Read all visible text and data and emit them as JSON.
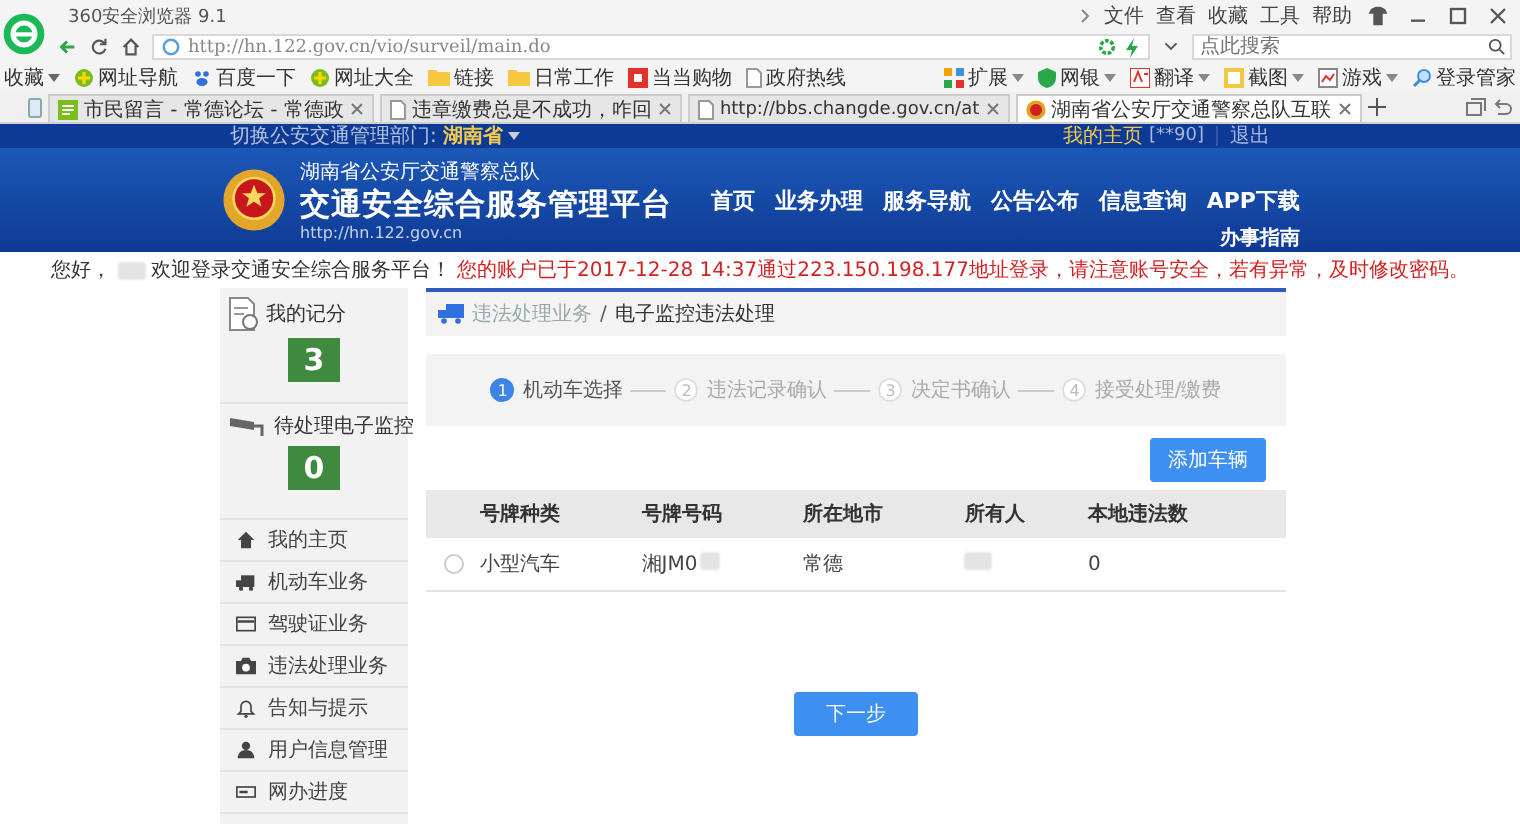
{
  "browser": {
    "title": "360安全浏览器 9.1",
    "menu": [
      "文件",
      "查看",
      "收藏",
      "工具",
      "帮助"
    ],
    "url": "http://hn.122.gov.cn/vio/surveil/main.do",
    "search": {
      "placeholder": "点此搜索"
    },
    "bookmarks": [
      {
        "label": "收藏",
        "kind": "menu"
      },
      {
        "label": "网址导航",
        "kind": "navigate"
      },
      {
        "label": "百度一下",
        "kind": "paw"
      },
      {
        "label": "网址大全",
        "kind": "navigate"
      },
      {
        "label": "链接",
        "kind": "folder"
      },
      {
        "label": "日常工作",
        "kind": "folder"
      },
      {
        "label": "当当购物",
        "kind": "shop"
      },
      {
        "label": "政府热线",
        "kind": "page"
      }
    ],
    "tools": [
      {
        "label": "扩展",
        "kind": "apps"
      },
      {
        "label": "网银",
        "kind": "shield"
      },
      {
        "label": "翻译",
        "kind": "translate"
      },
      {
        "label": "截图",
        "kind": "scissors"
      },
      {
        "label": "游戏",
        "kind": "game"
      },
      {
        "label": "登录管家",
        "kind": "account"
      }
    ],
    "tabs": [
      {
        "title": "市民留言 - 常德论坛 - 常德政",
        "kind": "forum",
        "selected": false
      },
      {
        "title": "违章缴费总是不成功，咋回",
        "kind": "page",
        "selected": false
      },
      {
        "title": "http://bbs.changde.gov.cn/at",
        "kind": "page",
        "selected": false
      },
      {
        "title": "湖南省公安厅交通警察总队互联",
        "kind": "emblem",
        "selected": true
      }
    ]
  },
  "site": {
    "switch_label": "切换公安交通管理部门:",
    "region": "湖南省",
    "home_link": "我的主页",
    "account": "[**90]",
    "logout": "退出",
    "org": "湖南省公安厅交通警察总队",
    "title": "交通安全综合服务管理平台",
    "address": "http://hn.122.gov.cn",
    "nav": [
      "首页",
      "业务办理",
      "服务导航",
      "公告公布",
      "信息查询",
      "APP下载"
    ],
    "nav_extra": "办事指南"
  },
  "welcome": {
    "greeting": "您好，",
    "message": "欢迎登录交通安全综合服务平台！",
    "notice": "您的账户已于2017-12-28 14:37通过223.150.198.177地址登录，请注意账号安全，若有异常，及时修改密码。"
  },
  "sidebar": {
    "stats": [
      {
        "label": "我的记分",
        "value": "3",
        "kind": "score"
      },
      {
        "label": "待处理电子监控",
        "value": "0",
        "kind": "camera"
      }
    ],
    "menu": [
      {
        "label": "我的主页",
        "kind": "home"
      },
      {
        "label": "机动车业务",
        "kind": "truck"
      },
      {
        "label": "驾驶证业务",
        "kind": "card"
      },
      {
        "label": "违法处理业务",
        "kind": "camera"
      },
      {
        "label": "告知与提示",
        "kind": "bell"
      },
      {
        "label": "用户信息管理",
        "kind": "user"
      },
      {
        "label": "网办进度",
        "kind": "progress"
      }
    ]
  },
  "breadcrumb": {
    "section": "违法处理业务",
    "separator": "/",
    "page": "电子监控违法处理"
  },
  "steps": [
    {
      "number": "1",
      "label": "机动车选择",
      "selected": true
    },
    {
      "number": "2",
      "label": "违法记录确认",
      "selected": false
    },
    {
      "number": "3",
      "label": "决定书确认",
      "selected": false
    },
    {
      "number": "4",
      "label": "接受处理/缴费",
      "selected": false
    }
  ],
  "add_button": "添加车辆",
  "table": {
    "columns": [
      "号牌种类",
      "号牌号码",
      "所在地市",
      "所有人",
      "本地违法数"
    ],
    "rows": [
      {
        "selected": false,
        "plate_type": "小型汽车",
        "plate_number": "湘JM0",
        "city": "常德",
        "local_violations": "0"
      }
    ]
  },
  "next_button": "下一步"
}
